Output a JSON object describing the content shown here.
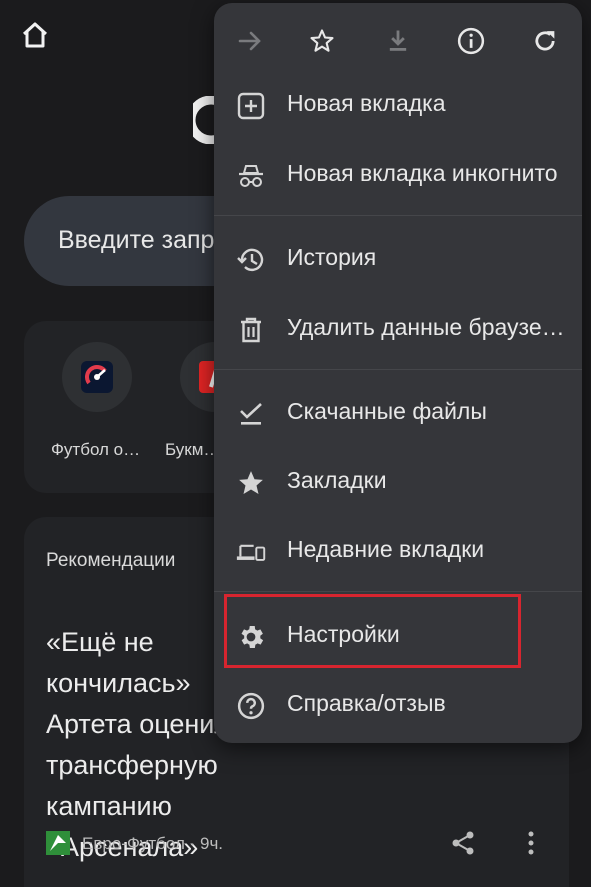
{
  "page": {
    "search_placeholder": "Введите запрос или URL",
    "shortcuts": [
      {
        "label": "Футбол о…"
      },
      {
        "label": "Букм…"
      }
    ],
    "recommendations_title": "Рекомендации",
    "article": {
      "headline": "«Ещё не кончилась» Артета оценил трансферную кампанию «Арсенала»",
      "source": "Евро-Футбол · 9ч."
    }
  },
  "menu": {
    "toolbar": [
      {
        "icon": "forward-arrow-icon"
      },
      {
        "icon": "star-outline-icon"
      },
      {
        "icon": "download-icon"
      },
      {
        "icon": "info-icon"
      },
      {
        "icon": "refresh-icon"
      }
    ],
    "items": [
      {
        "label": "Новая вкладка",
        "icon": "new-tab-icon"
      },
      {
        "label": "Новая вкладка инкогнито",
        "icon": "incognito-icon"
      },
      {
        "label": "История",
        "icon": "history-icon"
      },
      {
        "label": "Удалить данные браузера…",
        "icon": "trash-icon"
      },
      {
        "label": "Скачанные файлы",
        "icon": "downloads-check-icon"
      },
      {
        "label": "Закладки",
        "icon": "star-filled-icon"
      },
      {
        "label": "Недавние вкладки",
        "icon": "devices-icon"
      },
      {
        "label": "Настройки",
        "icon": "gear-icon"
      },
      {
        "label": "Справка/отзыв",
        "icon": "help-icon"
      }
    ]
  },
  "colors": {
    "background": "#1b1b1d",
    "menu": "#35363a",
    "highlight": "#d7252f"
  }
}
